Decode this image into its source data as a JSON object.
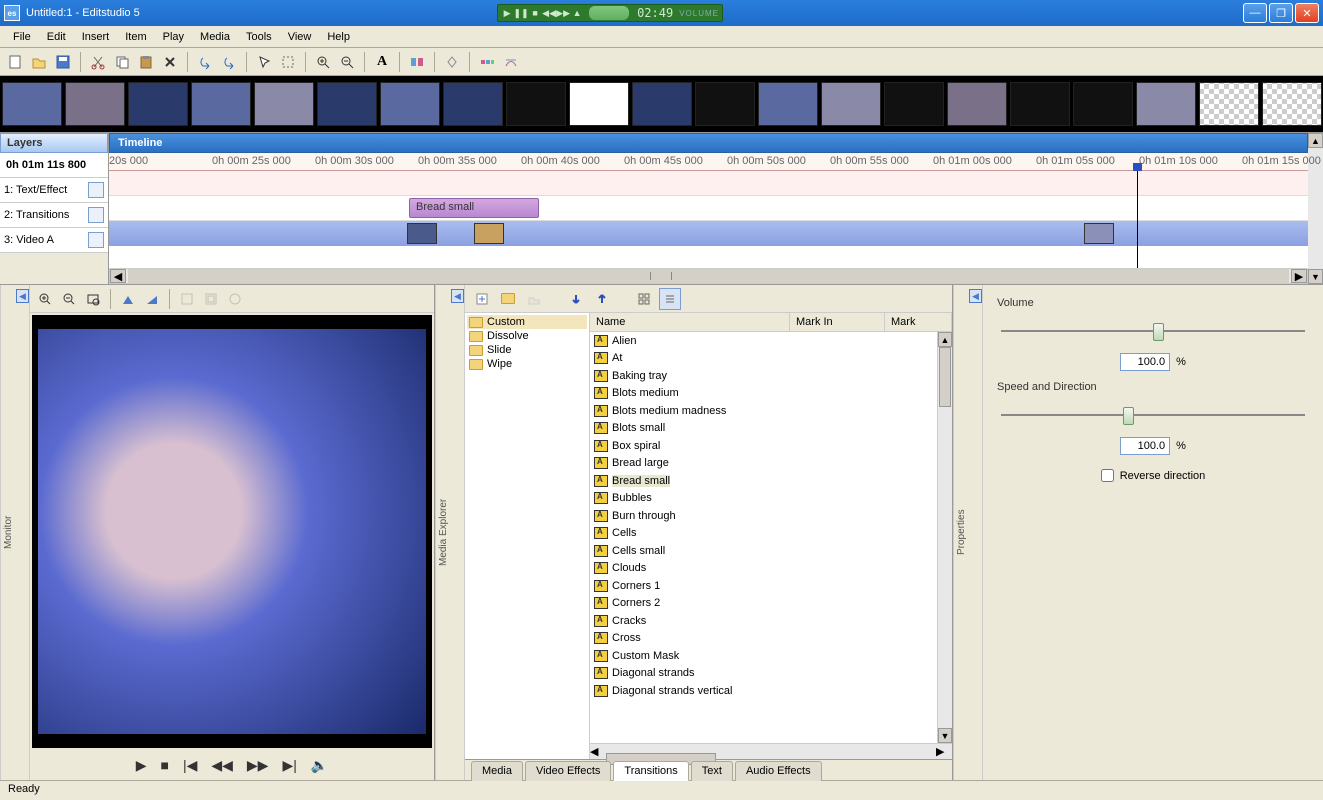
{
  "title": "Untitled:1 - Editstudio 5",
  "media_player": {
    "time": "02:49",
    "volume_label": "VOLUME"
  },
  "menu": [
    "File",
    "Edit",
    "Insert",
    "Item",
    "Play",
    "Media",
    "Tools",
    "View",
    "Help"
  ],
  "layers": {
    "header": "Layers",
    "time": "0h 01m 11s 800",
    "rows": [
      "1: Text/Effect",
      "2: Transitions",
      "3: Video A"
    ]
  },
  "timeline": {
    "header": "Timeline",
    "ticks": [
      "20s 000",
      "0h 00m 25s 000",
      "0h 00m 30s 000",
      "0h 00m 35s 000",
      "0h 00m 40s 000",
      "0h 00m 45s 000",
      "0h 00m 50s 000",
      "0h 00m 55s 000",
      "0h 01m 00s 000",
      "0h 01m 05s 000",
      "0h 01m 10s 000",
      "0h 01m 15s 000"
    ],
    "transition_clip": "Bread small"
  },
  "monitor_label": "Monitor",
  "explorer": {
    "label": "Media Explorer",
    "folders": [
      "Custom",
      "Dissolve",
      "Slide",
      "Wipe"
    ],
    "selected_folder": "Custom",
    "columns": [
      "Name",
      "Mark In",
      "Mark"
    ],
    "items": [
      "Alien",
      "At",
      "Baking tray",
      "Blots medium",
      "Blots medium madness",
      "Blots small",
      "Box spiral",
      "Bread large",
      "Bread small",
      "Bubbles",
      "Burn through",
      "Cells",
      "Cells small",
      "Clouds",
      "Corners 1",
      "Corners 2",
      "Cracks",
      "Cross",
      "Custom Mask",
      "Diagonal strands",
      "Diagonal strands vertical"
    ],
    "selected_item": "Bread small",
    "tabs": [
      "Media",
      "Video Effects",
      "Transitions",
      "Text",
      "Audio Effects"
    ],
    "active_tab": "Transitions"
  },
  "properties": {
    "label": "Properties",
    "volume_label": "Volume",
    "volume_value": "100.0",
    "volume_unit": "%",
    "speed_label": "Speed and Direction",
    "speed_value": "100.0",
    "speed_unit": "%",
    "reverse_label": "Reverse direction"
  },
  "status": "Ready"
}
